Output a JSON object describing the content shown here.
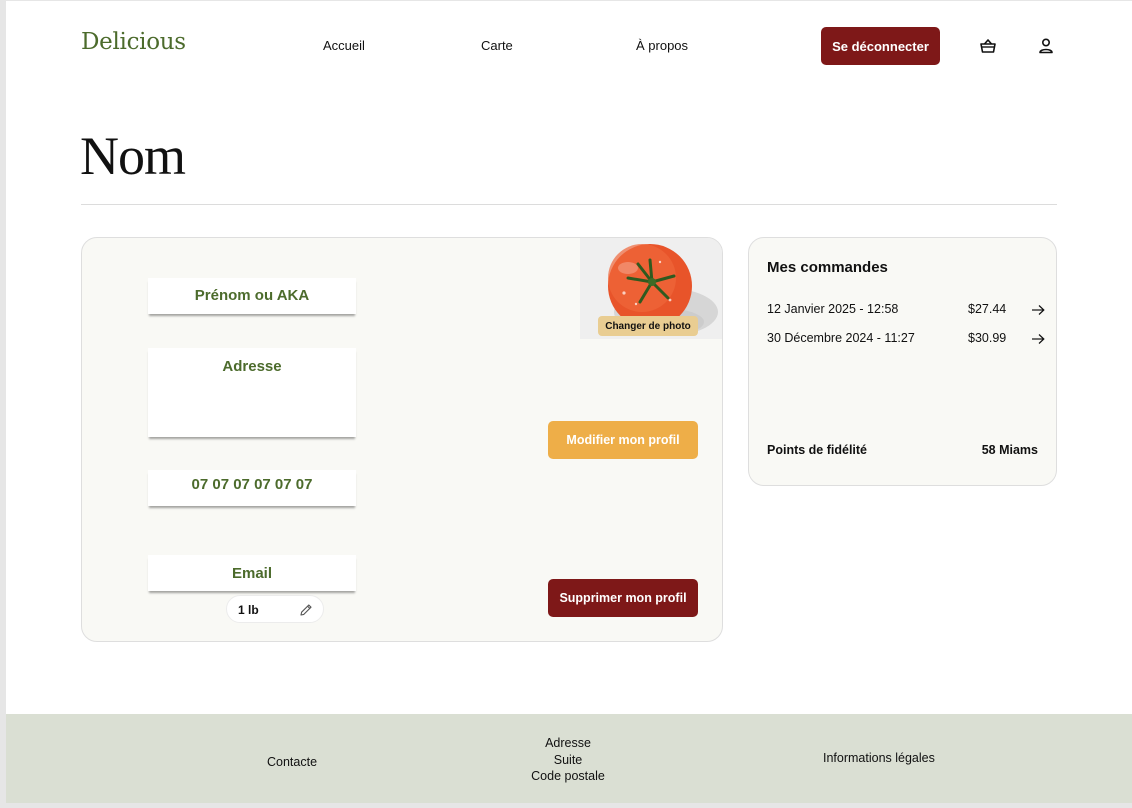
{
  "header": {
    "logo": "Delicious",
    "nav": [
      "Accueil",
      "Carte",
      "À propos"
    ],
    "logout_label": "Se déconnecter",
    "icons": [
      "basket-icon",
      "user-icon"
    ]
  },
  "page_title": "Nom",
  "profile": {
    "fields": {
      "name": "Prénom ou  AKA",
      "address": "Adresse",
      "phone": "07 07 07 07 07 07",
      "email": "Email"
    },
    "photo_button": "Changer de photo",
    "edit_button": "Modifier mon profil",
    "delete_button": "Supprimer mon profil",
    "quantity": "1 lb"
  },
  "orders": {
    "title": "Mes commandes",
    "items": [
      {
        "date": "12 Janvier 2025 - 12:58",
        "price": "$27.44"
      },
      {
        "date": "30 Décembre 2024 - 11:27",
        "price": "$30.99"
      }
    ],
    "loyalty_label": "Points de fidélité",
    "loyalty_value": "58 Miams"
  },
  "footer": {
    "contact": "Contacte",
    "address_lines": [
      "Adresse",
      "Suite",
      "Code postale"
    ],
    "legal": "Informations légales"
  },
  "colors": {
    "brand_green": "#4c6b2c",
    "dark_red": "#7e1818",
    "orange": "#eeae48",
    "card_bg": "#f9f9f5",
    "footer_bg": "#dadfd3"
  }
}
